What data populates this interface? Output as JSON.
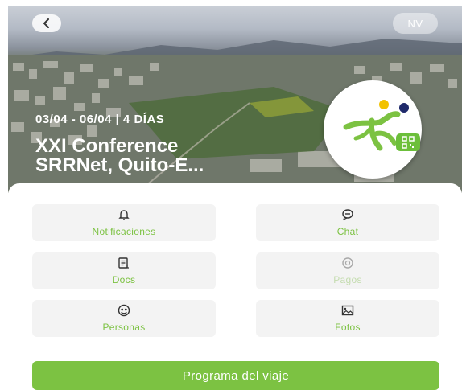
{
  "header": {
    "back_icon": "chevron-left-icon",
    "language_label": "NV"
  },
  "event": {
    "dates": "03/04 - 06/04 | 4 DÍAS",
    "title_line1": "XXI Conference",
    "title_line2": "SRRNet, Quito-E..."
  },
  "tiles": [
    {
      "label": "Notificaciones",
      "icon": "bell-icon",
      "enabled": true
    },
    {
      "label": "Chat",
      "icon": "chat-bubble-icon",
      "enabled": true
    },
    {
      "label": "Docs",
      "icon": "document-icon",
      "enabled": true
    },
    {
      "label": "Pagos",
      "icon": "coin-icon",
      "enabled": false
    },
    {
      "label": "Personas",
      "icon": "people-icon",
      "enabled": true
    },
    {
      "label": "Fotos",
      "icon": "image-icon",
      "enabled": true
    }
  ],
  "cta_label": "Programa del viaje",
  "colors": {
    "accent": "#7cc242",
    "accent_disabled": "#c4dcaf",
    "tile_bg": "#f3f3f3"
  }
}
